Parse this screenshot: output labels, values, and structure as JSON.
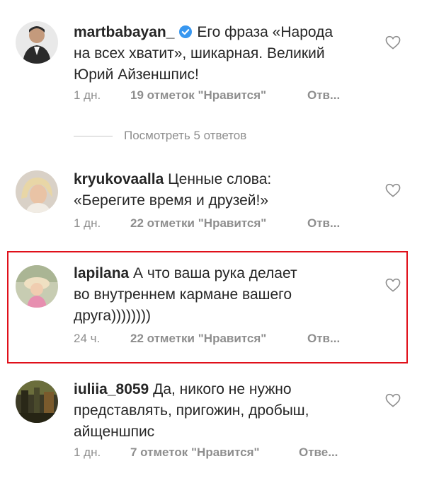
{
  "comments": [
    {
      "username": "martbabayan_",
      "verified": true,
      "text_lines": [
        "Его фраза «Народа",
        "на всех хватит», шикарная. Великий",
        "Юрий Айзеншпис!"
      ],
      "time": "1 дн.",
      "likes": "19 отметок \"Нравится\"",
      "reply": "Отв..."
    },
    {
      "username": "kryukovaalla",
      "verified": false,
      "text_lines": [
        "Ценные слова:",
        "«Берегите время и друзей!»"
      ],
      "time": "1 дн.",
      "likes": "22 отметки \"Нравится\"",
      "reply": "Отв..."
    },
    {
      "username": "lapilana",
      "verified": false,
      "text_lines": [
        "А что ваша рука делает",
        "во внутреннем кармане вашего",
        "друга))))))))"
      ],
      "time": "24 ч.",
      "likes": "22 отметки \"Нравится\"",
      "reply": "Отв..."
    },
    {
      "username": "iuliia_8059",
      "verified": false,
      "text_lines": [
        "Да, никого не нужно",
        "представлять, пригожин, дробыш,",
        "айщеншпис"
      ],
      "time": "1 дн.",
      "likes": "7 отметок \"Нравится\"",
      "reply": "Отве..."
    }
  ],
  "view_replies": "Посмотреть 5 ответов",
  "colors": {
    "highlight": "#e0101a",
    "secondary_text": "#8e8e8e",
    "verified": "#3897f0"
  }
}
